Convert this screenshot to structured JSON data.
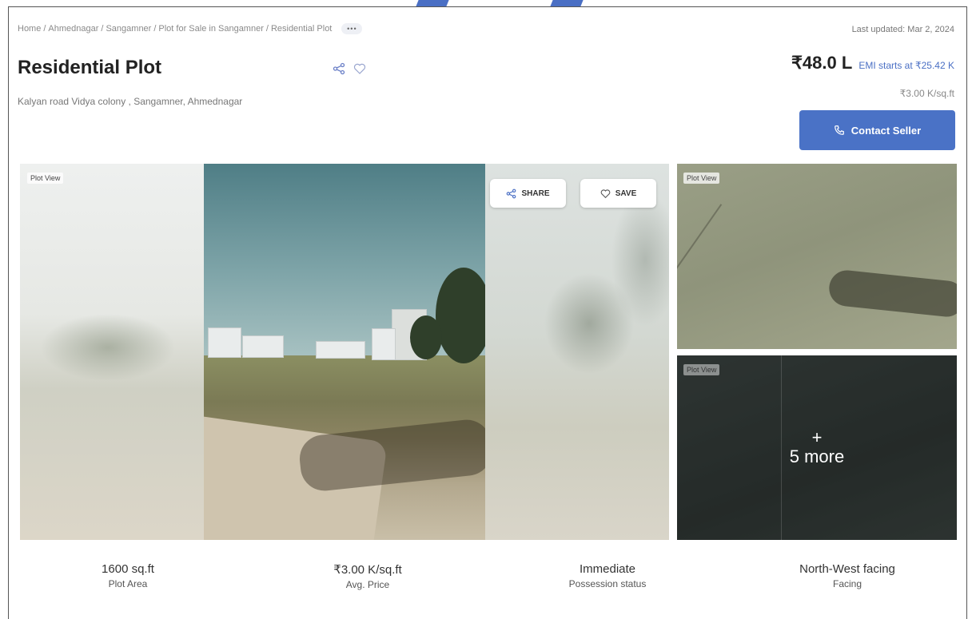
{
  "breadcrumb": {
    "items": [
      "Home",
      "Ahmednagar",
      "Sangamner",
      "Plot for Sale in Sangamner",
      "Residential Plot"
    ],
    "separator": "/",
    "more_label": "•••"
  },
  "last_updated": "Last updated: Mar 2, 2024",
  "listing": {
    "title": "Residential Plot",
    "address": "Kalyan road Vidya colony , Sangamner, Ahmednagar"
  },
  "pricing": {
    "price": "₹48.0 L",
    "emi": "EMI starts at ₹25.42 K",
    "per_sqft": "₹3.00 K/sq.ft"
  },
  "contact_button": "Contact Seller",
  "gallery": {
    "main_tag": "Plot View",
    "share_label": "SHARE",
    "save_label": "SAVE",
    "thumb1_tag": "Plot View",
    "thumb2_tag": "Plot View",
    "more_plus": "+",
    "more_label": "5 more"
  },
  "stats": [
    {
      "value": "1600 sq.ft",
      "label": "Plot Area"
    },
    {
      "value": "₹3.00 K/sq.ft",
      "label": "Avg. Price"
    },
    {
      "value": "Immediate",
      "label": "Possession status"
    },
    {
      "value": "North-West facing",
      "label": "Facing"
    }
  ],
  "icons": {
    "share": "share-icon",
    "heart": "heart-icon",
    "phone": "phone-icon",
    "more": "more-dots-icon"
  },
  "colors": {
    "accent": "#4a72c6",
    "emi_text": "#4a6fc4"
  }
}
